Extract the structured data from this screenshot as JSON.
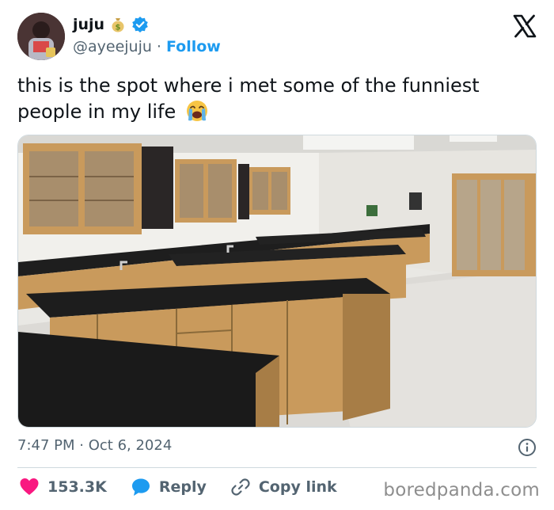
{
  "author": {
    "display_name": "juju",
    "name_emoji": "money-bag-icon",
    "verified_icon": "verified-badge-icon",
    "handle": "@ayeejuju",
    "separator": "·",
    "follow_label": "Follow"
  },
  "platform_icon": "x-logo-icon",
  "tweet": {
    "text": "this is the spot where i met some of the funniest people in my life",
    "trailing_emoji": "loudly-crying-face-icon"
  },
  "media": {
    "type": "photo",
    "subject": "school science lab with wooden cabinets and black-top islands"
  },
  "meta": {
    "time": "7:47 PM",
    "separator": "·",
    "date": "Oct 6, 2024"
  },
  "actions": {
    "like_count": "153.3K",
    "reply_label": "Reply",
    "copy_link_label": "Copy link"
  },
  "watermark": "boredpanda.com",
  "colors": {
    "accent": "#1d9bf0",
    "like": "#f91880",
    "text": "#0f1419",
    "muted": "#536471",
    "border": "#cfd9de"
  }
}
